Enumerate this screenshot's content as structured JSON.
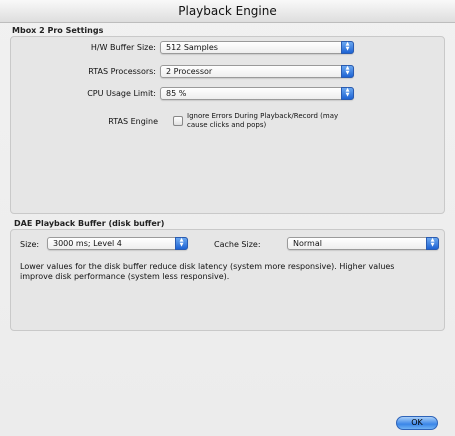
{
  "window": {
    "title": "Playback Engine"
  },
  "settings_group": {
    "title": "Mbox 2 Pro Settings",
    "hw_buffer": {
      "label": "H/W Buffer Size:",
      "value": "512 Samples"
    },
    "rtas_processors": {
      "label": "RTAS Processors:",
      "value": "2 Processor"
    },
    "cpu_usage": {
      "label": "CPU Usage Limit:",
      "value": "85 %"
    },
    "rtas_engine": {
      "label": "RTAS Engine",
      "checkbox_line1": "Ignore Errors During Playback/Record (may",
      "checkbox_line2": "cause clicks and pops)",
      "checked": false
    }
  },
  "dae_group": {
    "title": "DAE Playback Buffer (disk buffer)",
    "size": {
      "label": "Size:",
      "value": "3000 ms; Level 4"
    },
    "cache": {
      "label": "Cache Size:",
      "value": "Normal"
    },
    "description_line1": "Lower values for the disk buffer reduce disk latency (system more responsive).  Higher values",
    "description_line2": "improve disk performance (system less responsive)."
  },
  "buttons": {
    "ok": "OK"
  },
  "icons": {
    "popup": "up-down-arrows-icon"
  }
}
